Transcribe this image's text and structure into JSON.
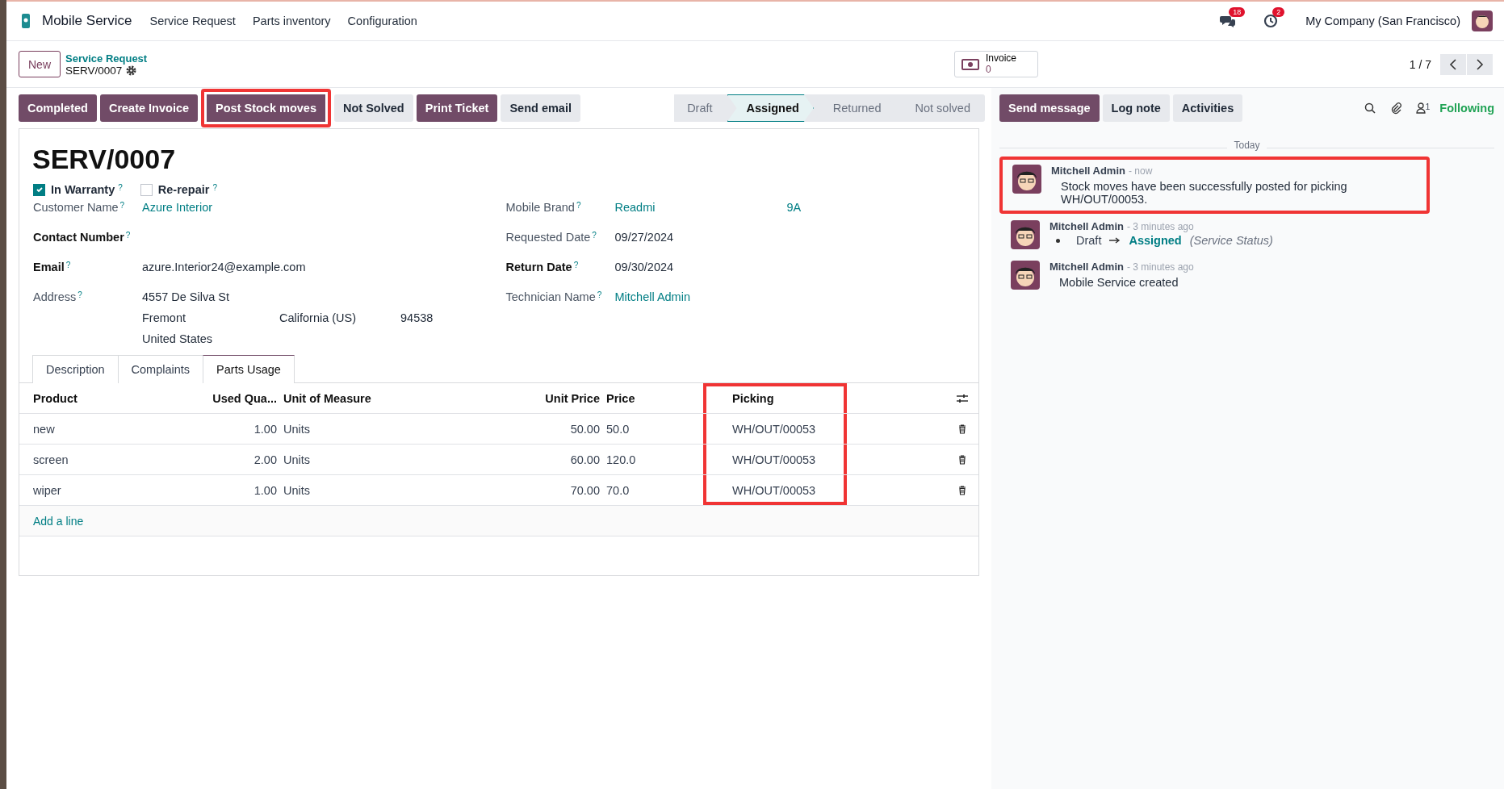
{
  "navbar": {
    "app_name": "Mobile Service",
    "menu": [
      "Service Request",
      "Parts inventory",
      "Configuration"
    ],
    "messages_count": "18",
    "activities_count": "2",
    "company": "My Company (San Francisco)"
  },
  "control_panel": {
    "new_button": "New",
    "breadcrumb": "Service Request",
    "record": "SERV/0007",
    "smart_button": {
      "label": "Invoice",
      "count": "0"
    },
    "pager": "1 / 7"
  },
  "actions": [
    {
      "label": "Completed",
      "kind": "primary",
      "highlighted": false
    },
    {
      "label": "Create Invoice",
      "kind": "primary",
      "highlighted": false
    },
    {
      "label": "Post Stock moves",
      "kind": "primary",
      "highlighted": true
    },
    {
      "label": "Not Solved",
      "kind": "secondary",
      "highlighted": false
    },
    {
      "label": "Print Ticket",
      "kind": "primary",
      "highlighted": false
    },
    {
      "label": "Send email",
      "kind": "secondary",
      "highlighted": false
    }
  ],
  "statusbar": [
    {
      "label": "Draft",
      "selected": false
    },
    {
      "label": "Assigned",
      "selected": true
    },
    {
      "label": "Returned",
      "selected": false
    },
    {
      "label": "Not solved",
      "selected": false
    }
  ],
  "chatter_buttons": [
    {
      "label": "Send message",
      "kind": "primary"
    },
    {
      "label": "Log note",
      "kind": "secondary"
    },
    {
      "label": "Activities",
      "kind": "secondary"
    }
  ],
  "followers_count": "1",
  "follow_label": "Following",
  "form": {
    "title": "SERV/0007",
    "checkboxes": [
      {
        "label": "In Warranty",
        "help": "?",
        "checked": true
      },
      {
        "label": "Re-repair",
        "help": "?",
        "checked": false
      }
    ],
    "left_fields": [
      {
        "label": "Customer Name",
        "help": "?",
        "bold": false,
        "kind": "link",
        "value": "Azure Interior"
      },
      {
        "label": "Contact Number",
        "help": "?",
        "bold": true,
        "kind": "text"
      },
      {
        "label": "Email",
        "help": "?",
        "bold": true,
        "kind": "text",
        "value": "azure.Interior24@example.com"
      },
      {
        "label": "Address",
        "help": "?",
        "bold": false,
        "kind": "address",
        "street": "4557 De Silva St",
        "city": "Fremont",
        "state": "California (US)",
        "zip": "94538",
        "country": "United States"
      }
    ],
    "right_fields": [
      {
        "label": "Mobile Brand",
        "help": "?",
        "bold": false,
        "kind": "link",
        "value": "Readmi",
        "extra": "9A"
      },
      {
        "label": "Requested Date",
        "help": "?",
        "bold": false,
        "kind": "text",
        "value": "09/27/2024"
      },
      {
        "label": "Return Date",
        "help": "?",
        "bold": true,
        "kind": "text",
        "value": "09/30/2024"
      },
      {
        "label": "Technician Name",
        "help": "?",
        "bold": false,
        "kind": "link",
        "value": "Mitchell Admin"
      }
    ],
    "tabs": [
      {
        "label": "Description",
        "selected": false
      },
      {
        "label": "Complaints",
        "selected": false
      },
      {
        "label": "Parts Usage",
        "selected": true
      }
    ],
    "table": {
      "columns": [
        {
          "label": "Product",
          "highlighted": false
        },
        {
          "label": "Used Qua...",
          "highlighted": false
        },
        {
          "label": "Unit of Measure",
          "highlighted": false
        },
        {
          "label": "Unit Price",
          "highlighted": false
        },
        {
          "label": "Price",
          "highlighted": false
        },
        {
          "label": "Picking",
          "highlighted": true
        }
      ],
      "rows": [
        [
          "new",
          "1.00",
          "Units",
          "50.00",
          "50.0",
          "WH/OUT/00053"
        ],
        [
          "screen",
          "2.00",
          "Units",
          "60.00",
          "120.0",
          "WH/OUT/00053"
        ],
        [
          "wiper",
          "1.00",
          "Units",
          "70.00",
          "70.0",
          "WH/OUT/00053"
        ]
      ],
      "add_line": "Add a line"
    }
  },
  "chatter": {
    "date_separator": "Today",
    "messages": [
      {
        "author": "Mitchell Admin",
        "time": "- now",
        "kind": "text",
        "body": "Stock moves have been successfully posted for picking WH/OUT/00053.",
        "highlighted": true
      },
      {
        "author": "Mitchell Admin",
        "time": "- 3 minutes ago",
        "kind": "tracking",
        "from": "Draft",
        "to": "Assigned",
        "field": "(Service Status)",
        "highlighted": false
      },
      {
        "author": "Mitchell Admin",
        "time": "- 3 minutes ago",
        "kind": "text",
        "body": "Mobile Service created",
        "highlighted": false
      }
    ]
  }
}
